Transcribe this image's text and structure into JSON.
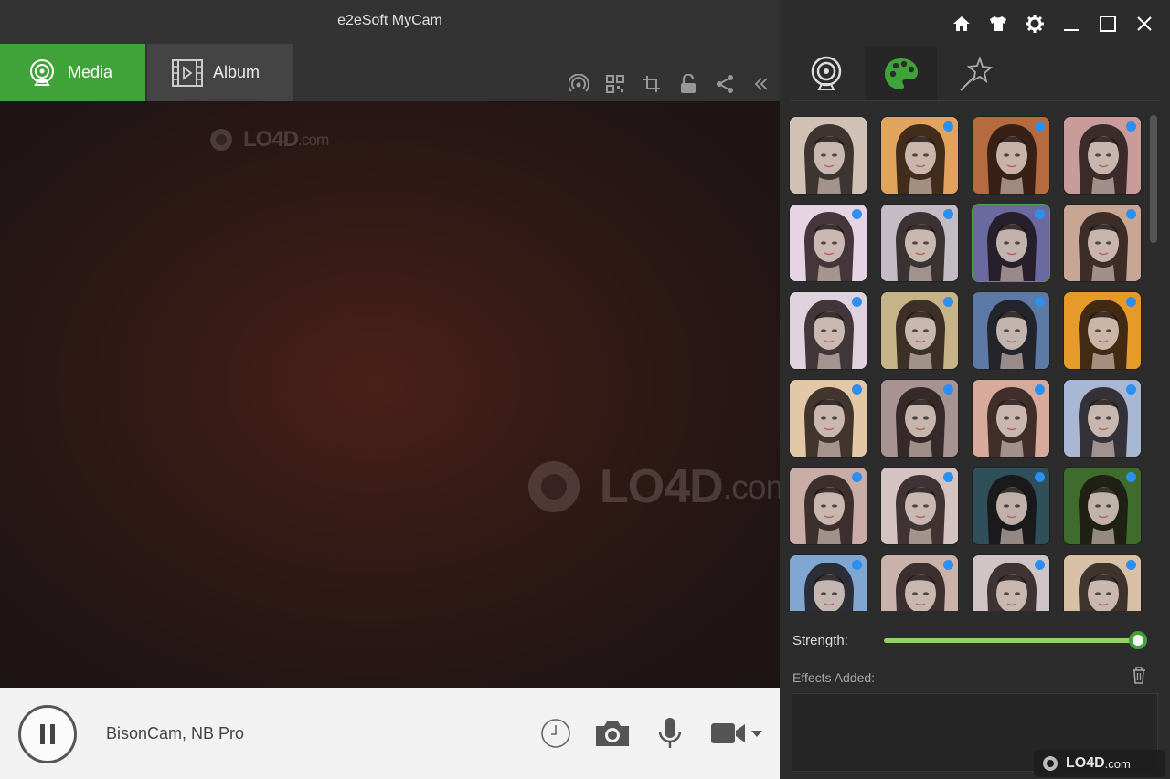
{
  "app": {
    "title": "e2eSoft MyCam"
  },
  "tabs": [
    {
      "label": "Media",
      "icon": "webcam-icon",
      "active": true
    },
    {
      "label": "Album",
      "icon": "film-icon",
      "active": false
    }
  ],
  "toolbar_icons": [
    "broadcast-icon",
    "qr-code-icon",
    "crop-icon",
    "unlock-icon",
    "share-icon",
    "collapse-icon"
  ],
  "preview": {
    "watermark": "LO4D",
    "watermark_suffix": ".com"
  },
  "controls": {
    "device_name": "BisonCam, NB Pro",
    "icons": [
      "pause-icon",
      "timer-icon",
      "camera-icon",
      "microphone-icon",
      "video-camera-icon",
      "dropdown-arrow-icon"
    ]
  },
  "window_buttons": [
    "home-icon",
    "skin-icon",
    "settings-icon",
    "minimize-icon",
    "maximize-icon",
    "close-icon"
  ],
  "right_tabs": [
    {
      "icon": "webcam-icon",
      "active": false
    },
    {
      "icon": "palette-icon",
      "active": true
    },
    {
      "icon": "magic-wand-icon",
      "active": false
    }
  ],
  "effects": {
    "filters": [
      {
        "tint": "#cfc2b4",
        "dot": false
      },
      {
        "tint": "#e2a45c",
        "dot": true
      },
      {
        "tint": "#b56a40",
        "dot": true
      },
      {
        "tint": "#c99c99",
        "dot": true
      },
      {
        "tint": "#e6d3e4",
        "dot": true
      },
      {
        "tint": "#c4bcc4",
        "dot": true
      },
      {
        "tint": "#6b6aa0",
        "dot": true
      },
      {
        "tint": "#c9a593",
        "dot": true
      },
      {
        "tint": "#ddd2de",
        "dot": true
      },
      {
        "tint": "#c6b387",
        "dot": true
      },
      {
        "tint": "#5d7aa6",
        "dot": true
      },
      {
        "tint": "#e59a2a",
        "dot": true
      },
      {
        "tint": "#e3c8a7",
        "dot": true
      },
      {
        "tint": "#a89393",
        "dot": true
      },
      {
        "tint": "#d8aa9c",
        "dot": true
      },
      {
        "tint": "#a7b7d4",
        "dot": true
      },
      {
        "tint": "#c9aca6",
        "dot": true
      },
      {
        "tint": "#d4c3c0",
        "dot": true
      },
      {
        "tint": "#2f4f5a",
        "dot": true
      },
      {
        "tint": "#3f6c2d",
        "dot": true
      },
      {
        "tint": "#7fa7d1",
        "dot": true
      },
      {
        "tint": "#c9b2aa",
        "dot": true
      },
      {
        "tint": "#d0c5c6",
        "dot": true
      },
      {
        "tint": "#d7c0a6",
        "dot": true
      }
    ],
    "selected_index": 6,
    "strength_label": "Strength:",
    "strength_value": 1.0,
    "effects_added_label": "Effects Added:"
  },
  "corner_watermark": {
    "text": "LO4D",
    "suffix": ".com"
  },
  "colors": {
    "accent": "#3fa33a",
    "slider": "#8fd46a",
    "dot": "#2d8ff0"
  }
}
